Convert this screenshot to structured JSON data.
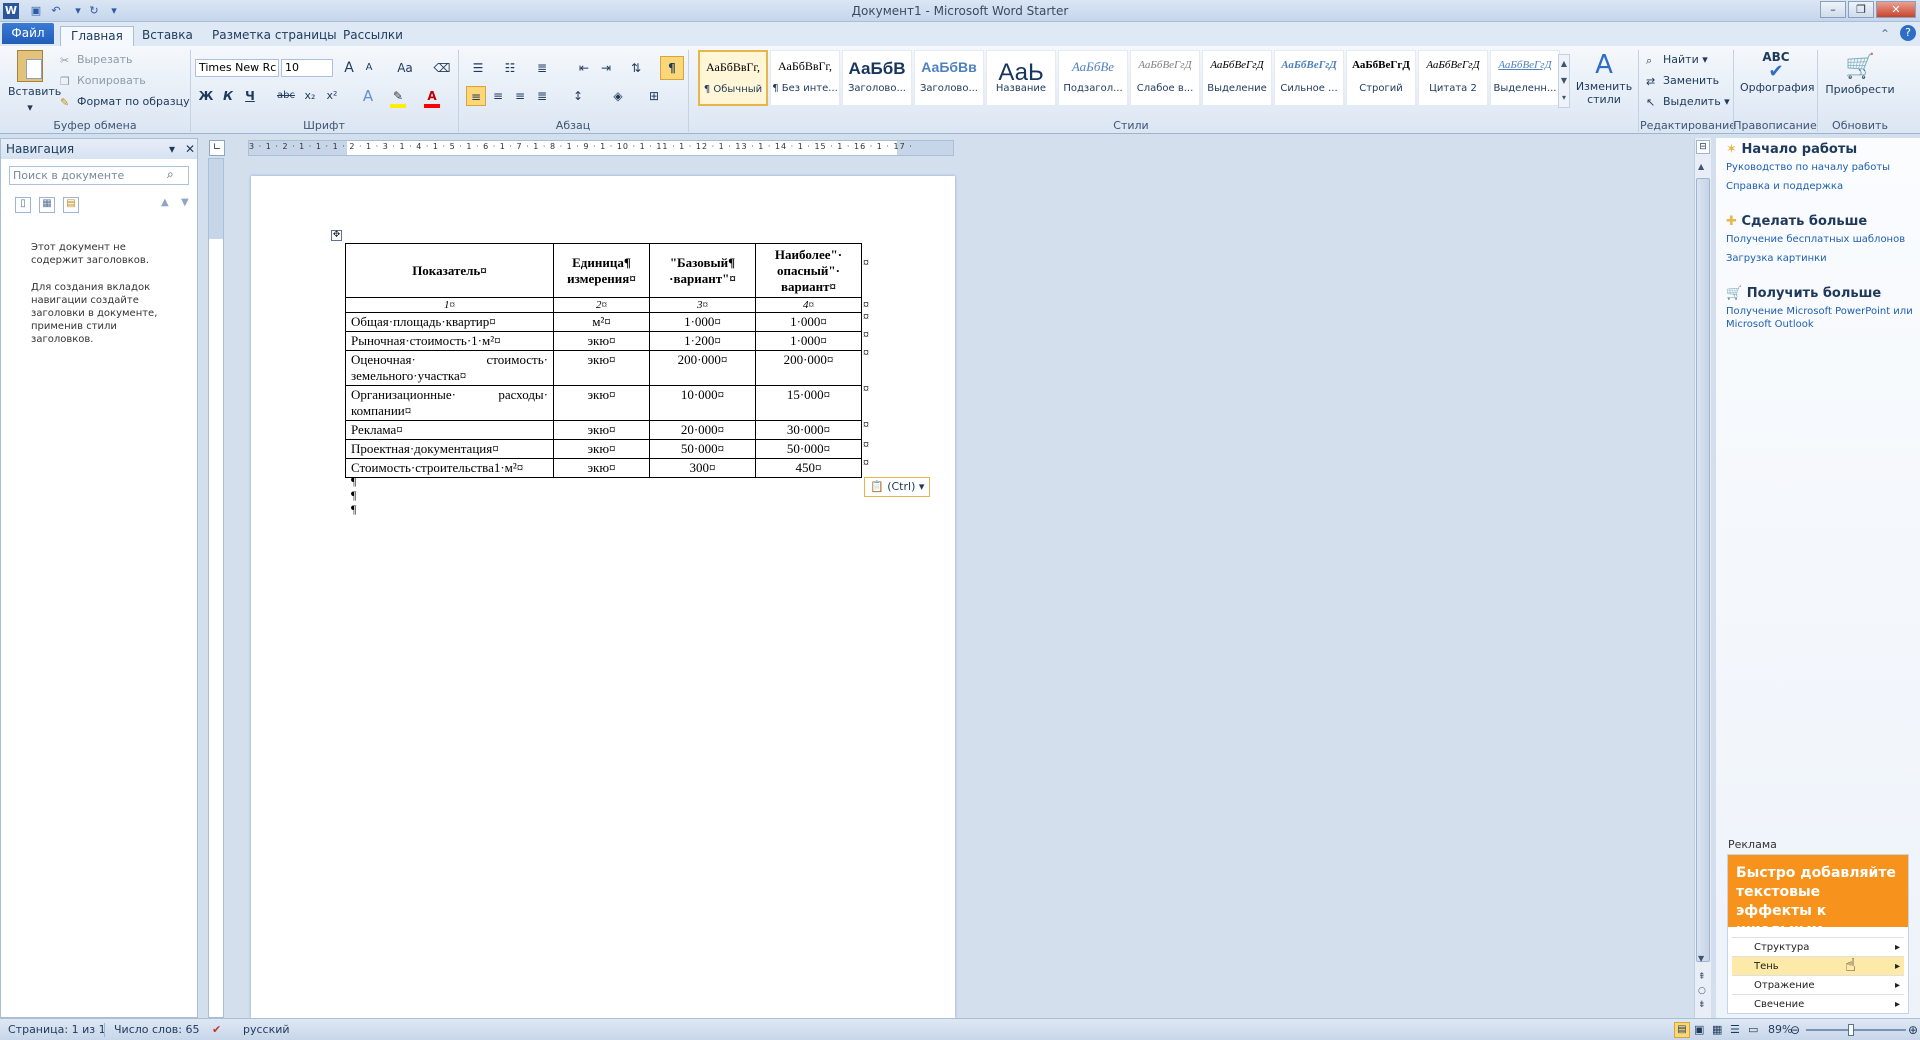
{
  "window": {
    "title": "Документ1 - Microsoft Word Starter"
  },
  "tabs": {
    "file": "Файл",
    "home": "Главная",
    "insert": "Вставка",
    "layout": "Разметка страницы",
    "mailings": "Рассылки"
  },
  "ribbon": {
    "clipboard": {
      "label": "Буфер обмена",
      "paste": "Вставить",
      "cut": "Вырезать",
      "copy": "Копировать",
      "format_painter": "Формат по образцу"
    },
    "font": {
      "label": "Шрифт",
      "family": "Times New Rc",
      "size": "10",
      "bold": "Ж",
      "italic": "К",
      "underline": "Ч",
      "strike": "abc",
      "sub": "x₂",
      "sup": "x²",
      "case": "Aa",
      "grow": "A",
      "shrink": "A"
    },
    "paragraph": {
      "label": "Абзац",
      "pilcrow": "¶"
    },
    "styles": {
      "label": "Стили",
      "change_styles": "Изменить стили",
      "items": [
        {
          "sample": "АаБбВвГг,",
          "name": "¶ Обычный"
        },
        {
          "sample": "АаБбВвГг,",
          "name": "¶ Без инте..."
        },
        {
          "sample": "АаБбВ",
          "name": "Заголово..."
        },
        {
          "sample": "АаБбВв",
          "name": "Заголово..."
        },
        {
          "sample": "АаЬ",
          "name": "Название"
        },
        {
          "sample": "АаБбВе",
          "name": "Подзагол..."
        },
        {
          "sample": "АаБбВеГгД",
          "name": "Слабое в..."
        },
        {
          "sample": "АаБбВеГгД",
          "name": "Выделение"
        },
        {
          "sample": "АаБбВеГгД",
          "name": "Сильное ..."
        },
        {
          "sample": "АаБбВеГгД",
          "name": "Строгий"
        },
        {
          "sample": "АаБбВеГгД",
          "name": "Цитата 2"
        },
        {
          "sample": "АаБбВеГгД",
          "name": "Выделенн..."
        }
      ]
    },
    "editing": {
      "label": "Редактирование",
      "find": "Найти",
      "replace": "Заменить",
      "select": "Выделить"
    },
    "proofing": {
      "label": "Правописание",
      "spelling": "Орфография",
      "abc": "ABC"
    },
    "update": {
      "label": "Обновить",
      "buy": "Приобрести"
    }
  },
  "nav": {
    "title": "Навигация",
    "search_placeholder": "Поиск в документе",
    "msg1": "Этот документ не содержит заголовков.",
    "msg2": "Для создания вкладок навигации создайте заголовки в документе, применив стили заголовков."
  },
  "ruler": {
    "marks": "3 · 1 · 2 · 1 · 1 · 1 · 2 · 1 · 3 · 1 · 4 · 1 · 5 · 1 · 6 · 1 · 7 · 1 · 8 · 1 · 9 · 1 · 10 · 1 · 11 · 1 · 12 · 1 · 13 · 1 · 14 · 1 · 15 · 1 · 16 · 1 · 17 ·"
  },
  "table": {
    "headers": [
      "Показатель¤",
      "Единица¶ измерения¤",
      "\"Базовый¶ ·вариант\"¤",
      "Наиболее\"· опасный\"· вариант¤"
    ],
    "numbering": [
      "1¤",
      "2¤",
      "3¤",
      "4¤"
    ],
    "rows": [
      [
        "Общая·площадь·квартир¤",
        "м²¤",
        "1·000¤",
        "1·000¤"
      ],
      [
        "Рыночная·стоимость·1·м²¤",
        "экю¤",
        "1·200¤",
        "1·000¤"
      ],
      [
        "Оценочная· стоимость· земельного·участка¤",
        "экю¤",
        "200·000¤",
        "200·000¤"
      ],
      [
        "Организационные· расходы· компании¤",
        "экю¤",
        "10·000¤",
        "15·000¤"
      ],
      [
        "Реклама¤",
        "экю¤",
        "20·000¤",
        "30·000¤"
      ],
      [
        "Проектная·документация¤",
        "экю¤",
        "50·000¤",
        "50·000¤"
      ],
      [
        "Стоимость·строительства1·м²¤",
        "экю¤",
        "300¤",
        "450¤"
      ]
    ],
    "end_marks": "¤",
    "para_marks": "¶"
  },
  "paste_options": "(Ctrl)",
  "right_pane": {
    "start": {
      "title": "Начало работы",
      "links": [
        "Руководство по началу работы",
        "Справка и поддержка"
      ]
    },
    "more": {
      "title": "Сделать больше",
      "links": [
        "Получение бесплатных шаблонов",
        "Загрузка картинки"
      ]
    },
    "get": {
      "title": "Получить больше",
      "links": [
        "Получение Microsoft PowerPoint или Microsoft Outlook"
      ]
    },
    "ad_label": "Реклама",
    "ad_title": "Быстро добавляйте текстовые эффекты к школьным проектам",
    "ad_items": [
      "Структура",
      "Тень",
      "Отражение",
      "Свечение"
    ]
  },
  "status": {
    "page": "Страница: 1 из 1",
    "words": "Число слов: 65",
    "lang": "русский",
    "zoom": "89%"
  }
}
